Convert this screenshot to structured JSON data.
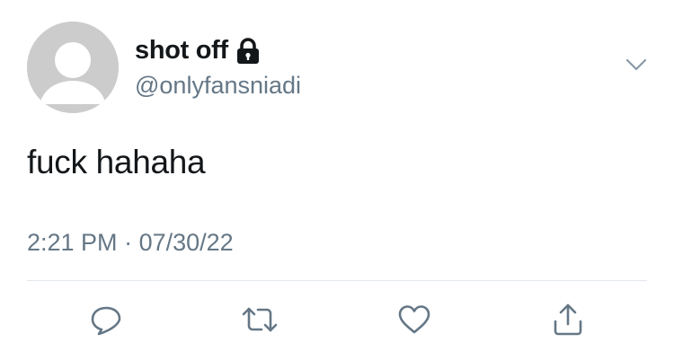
{
  "tweet": {
    "display_name": "shot off",
    "handle": "@onlyfansniadi",
    "text": "fuck hahaha",
    "time": "2:21 PM",
    "separator": "·",
    "date": "07/30/22",
    "protected_icon": "lock-icon",
    "menu_icon": "chevron-down-icon"
  },
  "actions": [
    {
      "name": "reply",
      "icon": "reply-icon"
    },
    {
      "name": "retweet",
      "icon": "retweet-icon"
    },
    {
      "name": "like",
      "icon": "heart-icon"
    },
    {
      "name": "share",
      "icon": "share-icon"
    }
  ],
  "colors": {
    "text_primary": "#14171a",
    "text_secondary": "#657786",
    "icon": "#657786",
    "avatar_bg": "#cccccc",
    "divider": "#e1e8ed"
  }
}
